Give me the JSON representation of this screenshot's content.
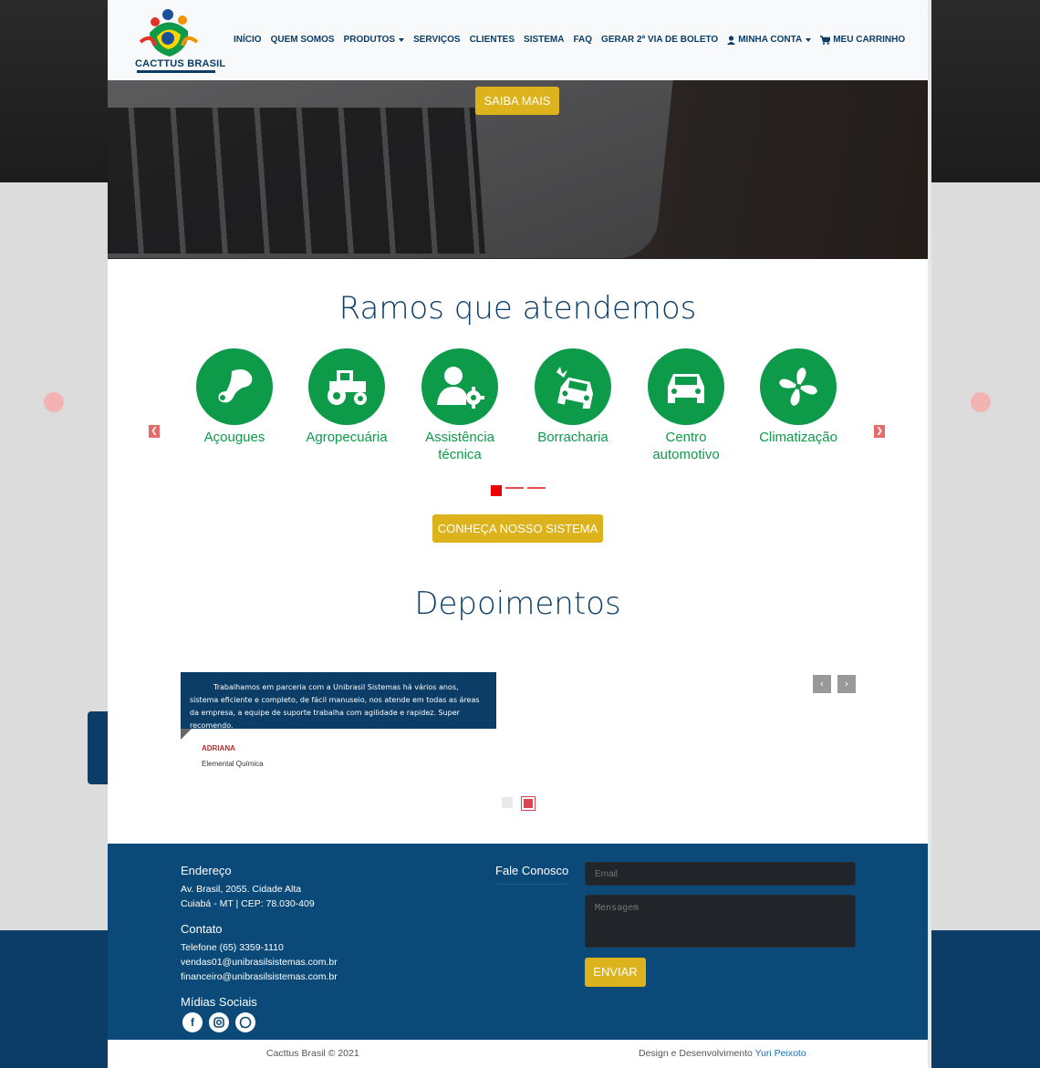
{
  "brand": {
    "name": "CACTTUS BRASIL"
  },
  "nav": {
    "items": [
      "INÍCIO",
      "QUEM SOMOS",
      "PRODUTOS",
      "SERVIÇOS",
      "CLIENTES",
      "SISTEMA",
      "FAQ",
      "GERAR 2ª VIA DE BOLETO",
      "MINHA CONTA",
      "MEU CARRINHO"
    ]
  },
  "hero": {
    "button": "SAIBA MAIS"
  },
  "branches": {
    "title": "Ramos que atendemos",
    "items": [
      {
        "label": "Açougues",
        "icon": "meat-icon"
      },
      {
        "label": "Agropecuária",
        "icon": "tractor-icon"
      },
      {
        "label": "Assistência técnica",
        "icon": "technician-icon"
      },
      {
        "label": "Borracharia",
        "icon": "car-crash-icon"
      },
      {
        "label": "Centro automotivo",
        "icon": "car-icon"
      },
      {
        "label": "Climatização",
        "icon": "fan-icon"
      }
    ],
    "cta": "CONHEÇA NOSSO SISTEMA"
  },
  "testimonials": {
    "title": "Depoimentos",
    "quote": "Trabalhamos em parceria com a Unibrasil Sistemas há vários anos, sistema eficiente e completo, de fácil manuseio, nos atende em todas as áreas da empresa, a equipe de suporte trabalha com agilidade e rapidez. Super recomendo.",
    "author": "ADRIANA",
    "company": "Elemental Química"
  },
  "footer": {
    "address_title": "Endereço",
    "address_line1": "Av. Brasil, 2055. Cidade Alta",
    "address_line2": "Cuiabá - MT | CEP: 78.030-409",
    "contact_title": "Contato",
    "phone": "Telefone (65) 3359-1110",
    "email1": "vendas01@unibrasilsistemas.com.br",
    "email2": "financeiro@unibrasilsistemas.com.br",
    "social_title": "Mídias Sociais",
    "form_title": "Fale Conosco",
    "email_placeholder": "Email",
    "message_placeholder": "Mensagem",
    "send": "ENVIAR",
    "copyright": "Cacttus Brasil © 2021",
    "credit": "Design e Desenvolvimento",
    "credit_name": "Yuri Peixoto"
  },
  "colors": {
    "primary": "#0b3d66",
    "green": "#0d9b4a",
    "yellow": "#dcb21d",
    "red": "#e00000"
  }
}
